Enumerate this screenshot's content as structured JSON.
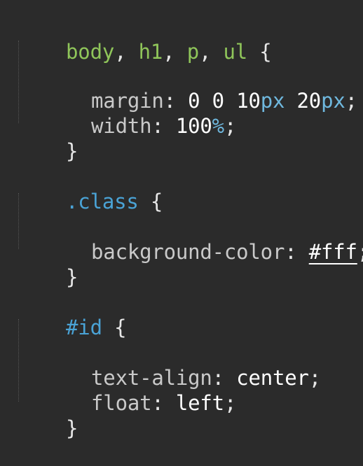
{
  "editor": {
    "language": "css",
    "colors": {
      "background": "#2b2b2b",
      "selector": "#8fc55a",
      "class_selector": "#4aa3d6",
      "property": "#c9c9c9",
      "number": "#ffffff",
      "unit": "#6fb8de"
    },
    "rule1": {
      "sel1": "body",
      "sel2": "h1",
      "sel3": "p",
      "sel4": "ul",
      "comma": ",",
      "open": "{",
      "close": "}",
      "decl1": {
        "prop": "margin",
        "colon": ":",
        "v1": "0",
        "v2": "0",
        "v3num": "10",
        "v3unit": "px",
        "v4num": "20",
        "v4unit": "px",
        "semi": ";"
      },
      "decl2": {
        "prop": "width",
        "colon": ":",
        "vnum": "100",
        "vunit": "%",
        "semi": ";"
      }
    },
    "rule2": {
      "selector": ".class",
      "open": "{",
      "close": "}",
      "decl1": {
        "prop": "background-color",
        "colon": ":",
        "value": "#fff",
        "semi": ";"
      }
    },
    "rule3": {
      "selector": "#id",
      "open": "{",
      "close": "}",
      "decl1": {
        "prop": "text-align",
        "colon": ":",
        "value": "center",
        "semi": ";"
      },
      "decl2": {
        "prop": "float",
        "colon": ":",
        "value": "left",
        "semi": ";"
      }
    }
  }
}
